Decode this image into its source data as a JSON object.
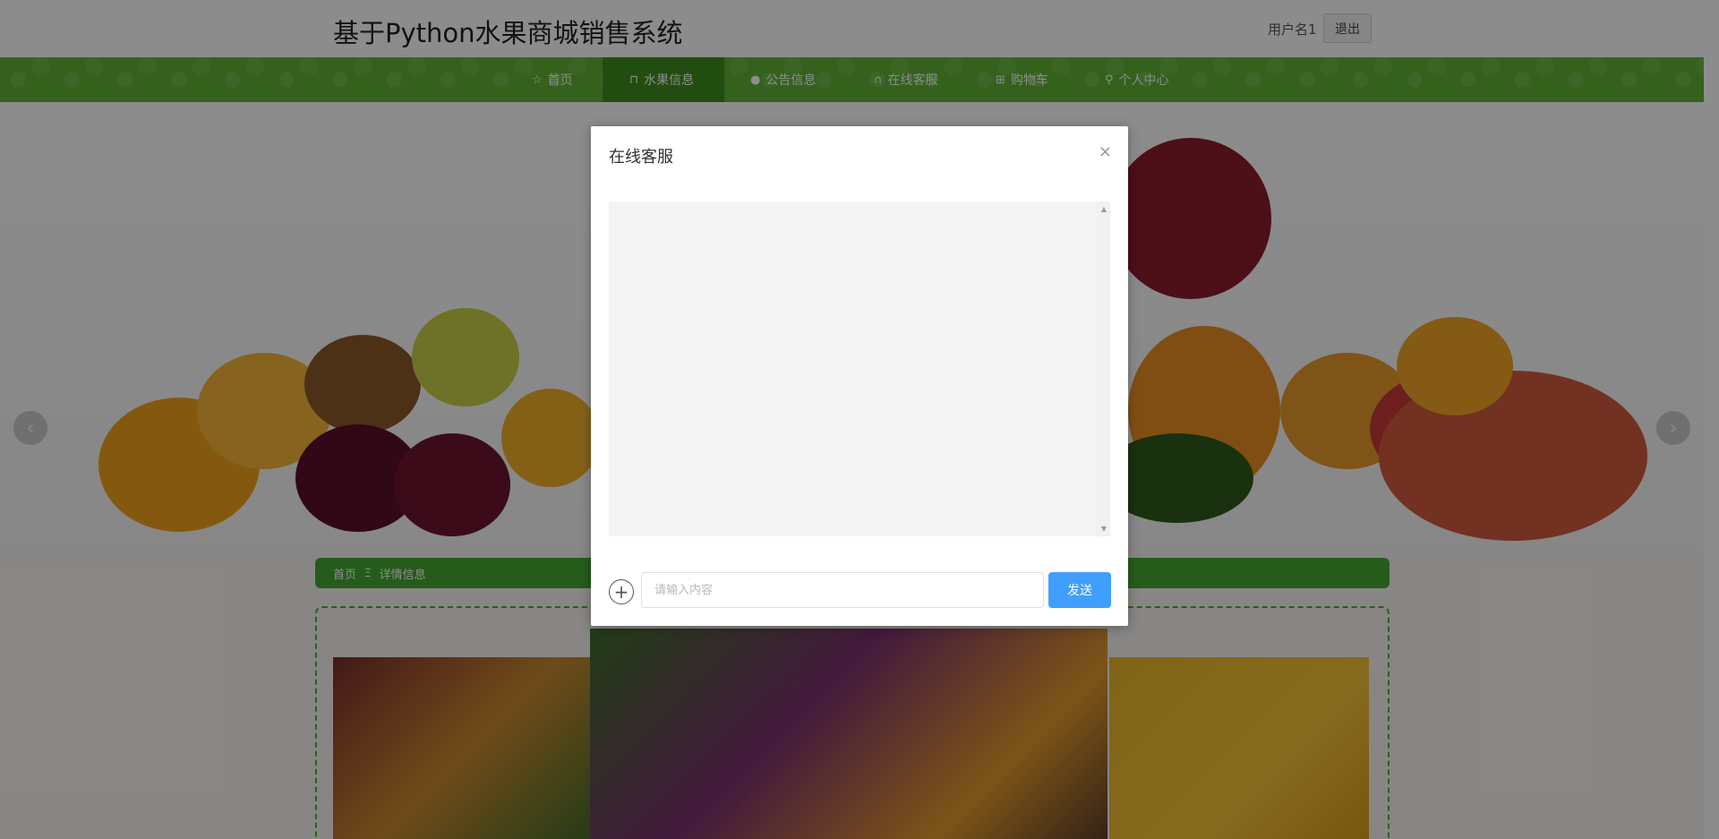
{
  "header": {
    "site_title": "基于Python水果商城销售系统",
    "user_name": "用户名1",
    "logout_label": "退出"
  },
  "nav": {
    "items": [
      {
        "label": "首页",
        "icon": "star-icon",
        "glyph": "☆",
        "active": false
      },
      {
        "label": "水果信息",
        "icon": "bag-icon",
        "glyph": "⊓",
        "active": true
      },
      {
        "label": "公告信息",
        "icon": "info-icon",
        "glyph": "●",
        "active": false
      },
      {
        "label": "在线客服",
        "icon": "headset-icon",
        "glyph": "∩",
        "active": false
      },
      {
        "label": "购物车",
        "icon": "cart-icon",
        "glyph": "⊞",
        "active": false
      },
      {
        "label": "个人中心",
        "icon": "user-icon",
        "glyph": "⚲",
        "active": false
      }
    ]
  },
  "banner": {
    "prev_glyph": "‹",
    "next_glyph": "›"
  },
  "breadcrumb": {
    "home": "首页",
    "separator": "Ξ",
    "current": "详情信息"
  },
  "modal": {
    "title": "在线客服",
    "close_glyph": "×",
    "attach_glyph": "+",
    "input_placeholder": "请输入内容",
    "input_value": "",
    "send_label": "发送"
  },
  "colors": {
    "nav_green": "#5fb336",
    "nav_active": "#3f8c1e",
    "breadcrumb_green": "#44a832",
    "send_blue": "#409eff"
  }
}
